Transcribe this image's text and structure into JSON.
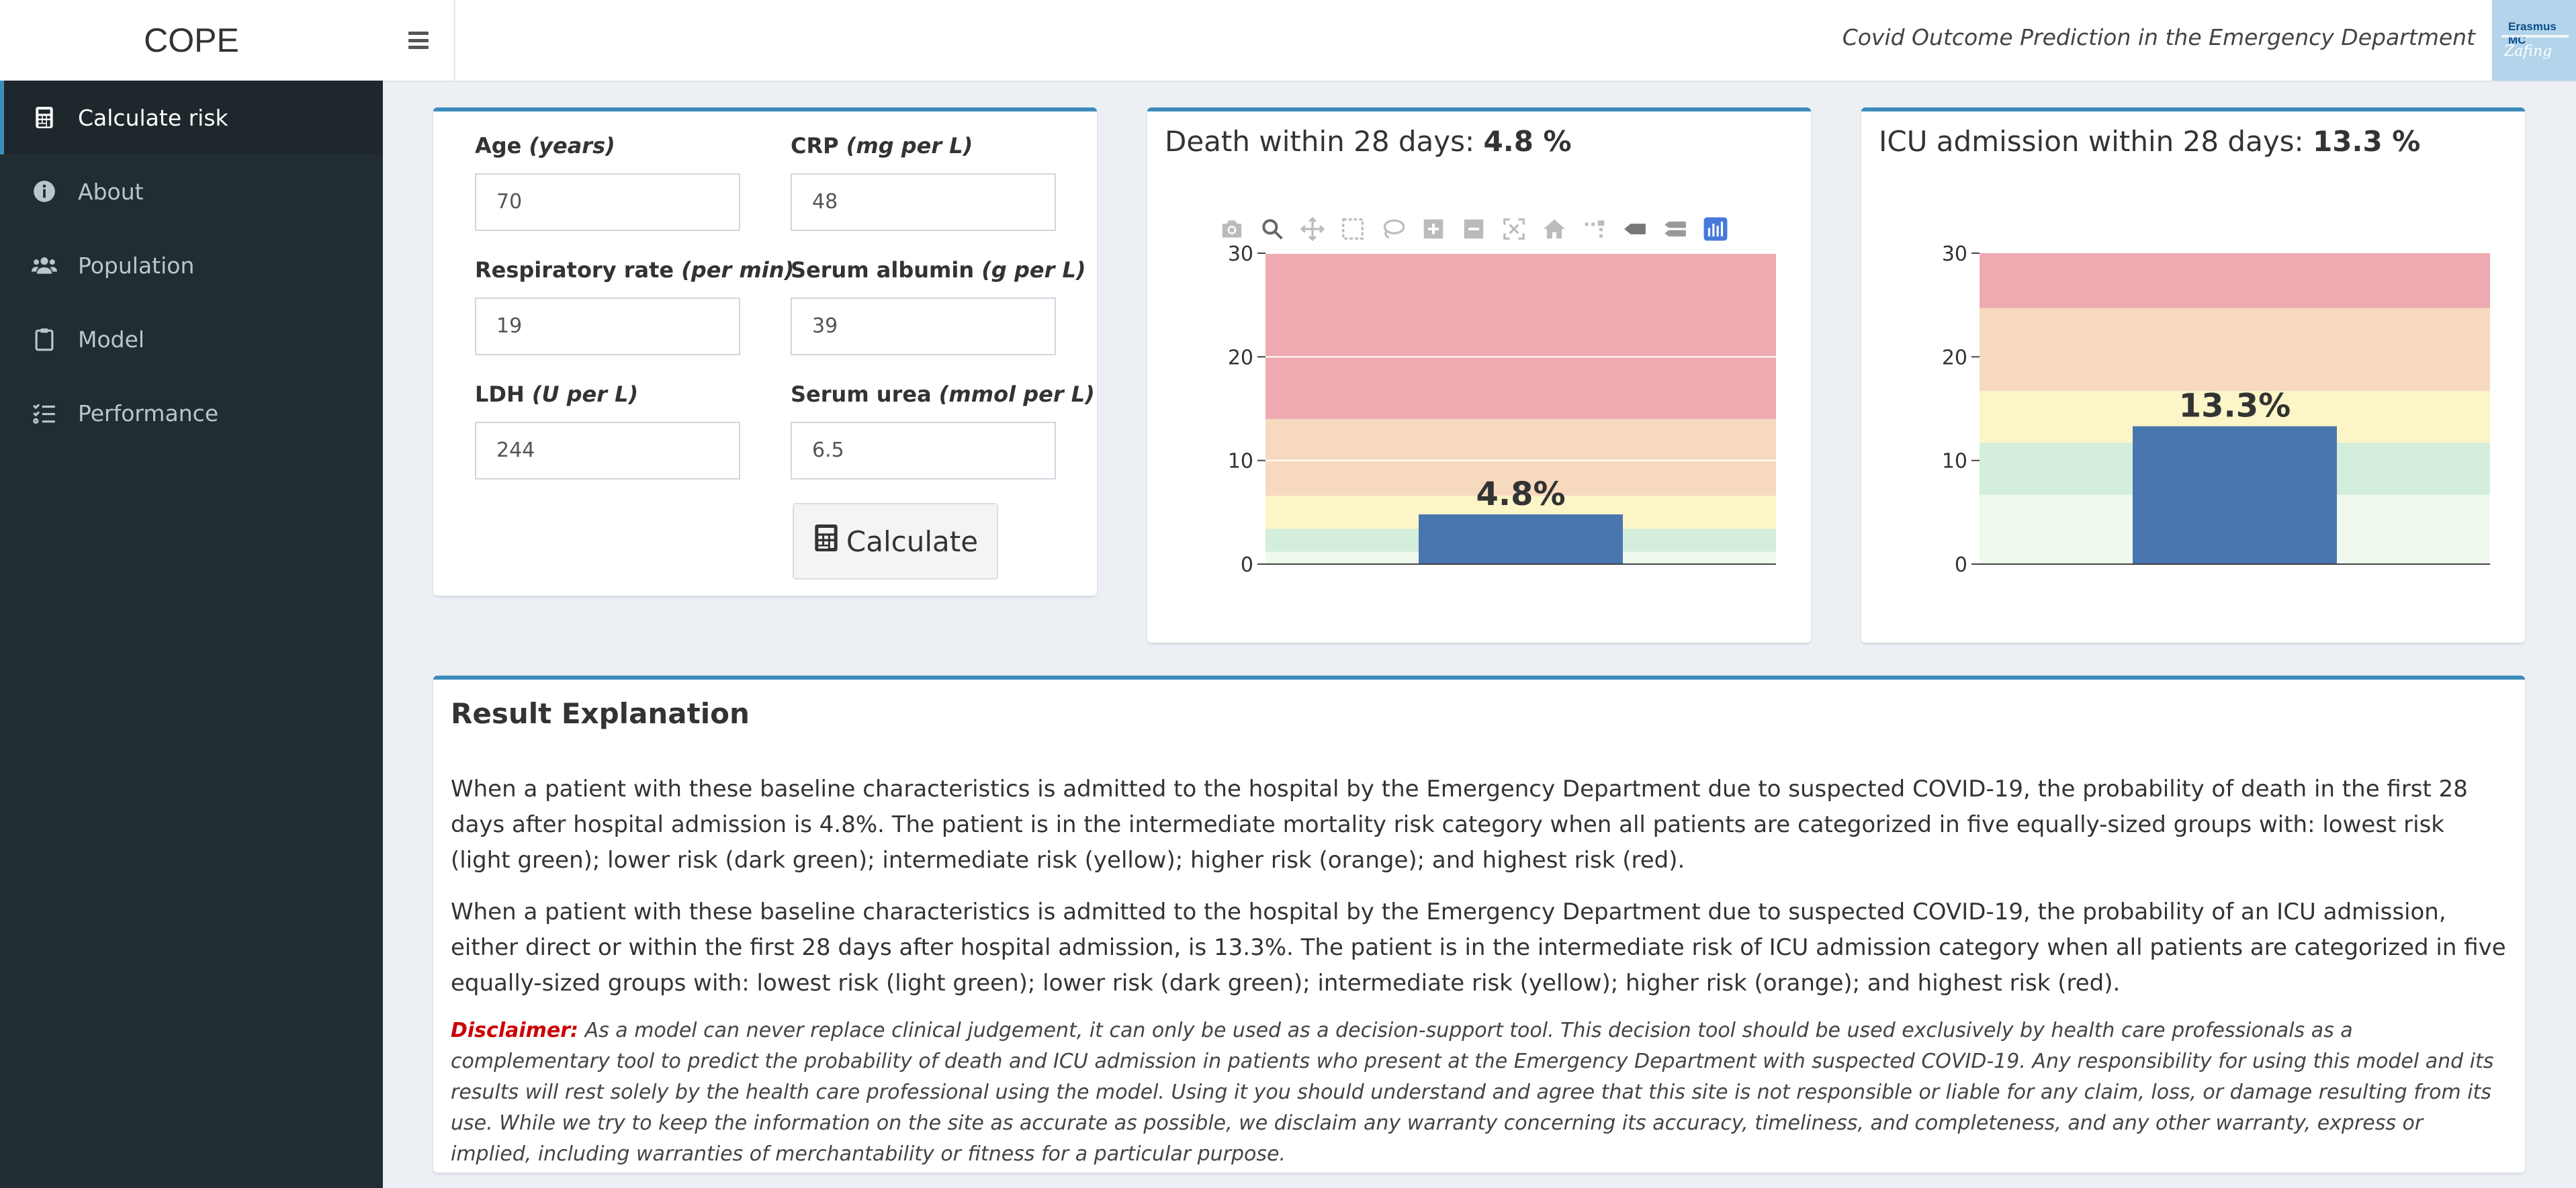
{
  "app": {
    "logo_text": "COPE",
    "header_title": "Covid Outcome Prediction in the Emergency Department",
    "brand_text": "Erasmus MC",
    "brand_script": "Zafing"
  },
  "sidebar": {
    "items": [
      {
        "label": "Calculate risk",
        "icon": "calculator-icon",
        "active": true
      },
      {
        "label": "About",
        "icon": "info-circle-icon",
        "active": false
      },
      {
        "label": "Population",
        "icon": "users-icon",
        "active": false
      },
      {
        "label": "Model",
        "icon": "clipboard-icon",
        "active": false
      },
      {
        "label": "Performance",
        "icon": "tasks-icon",
        "active": false
      }
    ]
  },
  "form": {
    "fields": [
      {
        "label": "Age",
        "unit": "(years)",
        "value": "70"
      },
      {
        "label": "CRP",
        "unit": "(mg per L)",
        "value": "48"
      },
      {
        "label": "Respiratory rate",
        "unit": "(per min)",
        "value": "19"
      },
      {
        "label": "Serum albumin",
        "unit": "(g per L)",
        "value": "39"
      },
      {
        "label": "LDH",
        "unit": "(U per L)",
        "value": "244"
      },
      {
        "label": "Serum urea",
        "unit": "(mmol per L)",
        "value": "6.5"
      }
    ],
    "calculate_label": "Calculate"
  },
  "colors": {
    "accent": "#3c8dbc",
    "bar": "#4a76b0",
    "band_lightest_green": "#f0f9ee",
    "band_dark_green": "#d3eedb",
    "band_yellow": "#fbf5c7",
    "band_orange": "#f7d9bf",
    "band_red": "#eeaab0"
  },
  "chart_data": [
    {
      "type": "bar",
      "title_prefix": "Death within 28 days: ",
      "title_value": "4.8 %",
      "values": [
        4.8
      ],
      "bar_label": "4.8%",
      "ylim": [
        0,
        30
      ],
      "y_ticks": [
        "0",
        "10",
        "20",
        "30"
      ],
      "risk_bands": [
        [
          0,
          1.2
        ],
        [
          1.2,
          3.4
        ],
        [
          3.4,
          6.6
        ],
        [
          6.6,
          14
        ],
        [
          14,
          30
        ]
      ],
      "grid": true,
      "modebar": true
    },
    {
      "type": "bar",
      "title_prefix": "ICU admission within 28 days: ",
      "title_value": "13.3 %",
      "values": [
        13.3
      ],
      "bar_label": "13.3%",
      "ylim": [
        0,
        30
      ],
      "y_ticks": [
        "0",
        "10",
        "20",
        "30"
      ],
      "risk_bands": [
        [
          0,
          6.7
        ],
        [
          6.7,
          11.7
        ],
        [
          11.7,
          16.7
        ],
        [
          16.7,
          24.7
        ],
        [
          24.7,
          30
        ]
      ],
      "grid": false,
      "modebar": false
    }
  ],
  "explanation": {
    "title": "Result Explanation",
    "p1": "When a patient with these baseline characteristics is admitted to the hospital by the Emergency Department due to suspected COVID-19, the probability of death in the first 28 days after hospital admission is 4.8%. The patient is in the intermediate mortality risk category when all patients are categorized in five equally-sized groups with: lowest risk (light green); lower risk (dark green); intermediate risk (yellow); higher risk (orange); and highest risk (red).",
    "p2": "When a patient with these baseline characteristics is admitted to the hospital by the Emergency Department due to suspected COVID-19, the probability of an ICU admission, either direct or within the first 28 days after hospital admission, is 13.3%. The patient is in the intermediate risk of ICU admission category when all patients are categorized in five equally-sized groups with: lowest risk (light green); lower risk (dark green); intermediate risk (yellow); higher risk (orange); and highest risk (red).",
    "disclaimer_label": "Disclaimer:",
    "disclaimer_text": " As a model can never replace clinical judgement, it can only be used as a decision-support tool. This decision tool should be used exclusively by health care professionals as a complementary tool to predict the probability of death and ICU admission in patients who present at the Emergency Department with suspected COVID-19. Any responsibility for using this model and its results will rest solely by the health care professional using the model. Using it you should understand and agree that this site is not responsible or liable for any claim, loss, or damage resulting from its use. While we try to keep the information on the site as accurate as possible, we disclaim any warranty concerning its accuracy, timeliness, and completeness, and any other warranty, express or implied, including warranties of merchantability or fitness for a particular purpose."
  }
}
